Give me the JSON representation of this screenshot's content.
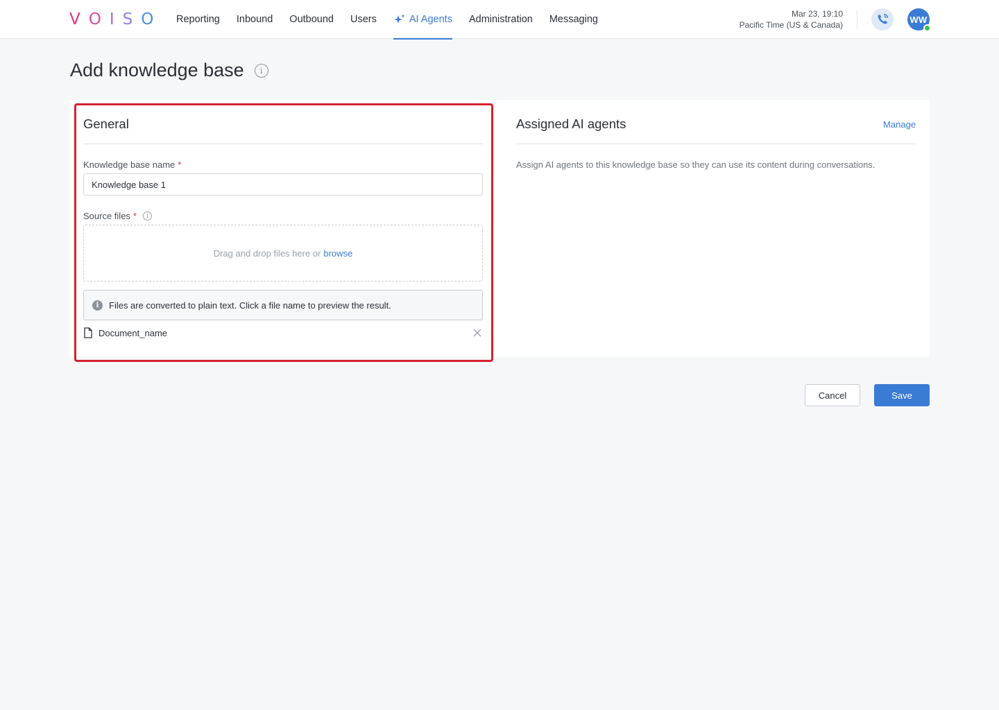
{
  "app": {
    "logo_letters": [
      "V",
      "O",
      "I",
      "S",
      "O"
    ],
    "logo_colors": [
      "#e8327c",
      "#d24fa3",
      "#a86cd3",
      "#8b84e2",
      "#4a8fe7"
    ]
  },
  "nav": {
    "items": [
      {
        "label": "Reporting",
        "active": false
      },
      {
        "label": "Inbound",
        "active": false
      },
      {
        "label": "Outbound",
        "active": false
      },
      {
        "label": "Users",
        "active": false
      },
      {
        "label": "AI Agents",
        "active": true,
        "icon": "sparkle-icon"
      },
      {
        "label": "Administration",
        "active": false
      },
      {
        "label": "Messaging",
        "active": false
      }
    ]
  },
  "header": {
    "datetime": "Mar 23, 19:10",
    "timezone": "Pacific Time (US & Canada)",
    "phone_icon": "phone-icon",
    "avatar_initials": "WW",
    "status_color": "#3cc14e"
  },
  "page": {
    "title": "Add knowledge base"
  },
  "general": {
    "heading": "General",
    "name_label": "Knowledge base name",
    "name_value": "Knowledge base 1",
    "required_mark": "*",
    "source_label": "Source files",
    "dropzone_text": "Drag and drop files here or",
    "browse_label": "browse",
    "notice_text": "Files are converted to plain text. Click a file name to preview the result.",
    "files": [
      {
        "name": "Document_name"
      }
    ]
  },
  "assigned": {
    "heading": "Assigned AI agents",
    "manage_label": "Manage",
    "description": "Assign AI agents to this knowledge base so they can use its content during conversations."
  },
  "actions": {
    "cancel_label": "Cancel",
    "save_label": "Save"
  },
  "colors": {
    "accent": "#3a7bd5",
    "highlight": "#d6212f",
    "required": "#e0303c"
  }
}
